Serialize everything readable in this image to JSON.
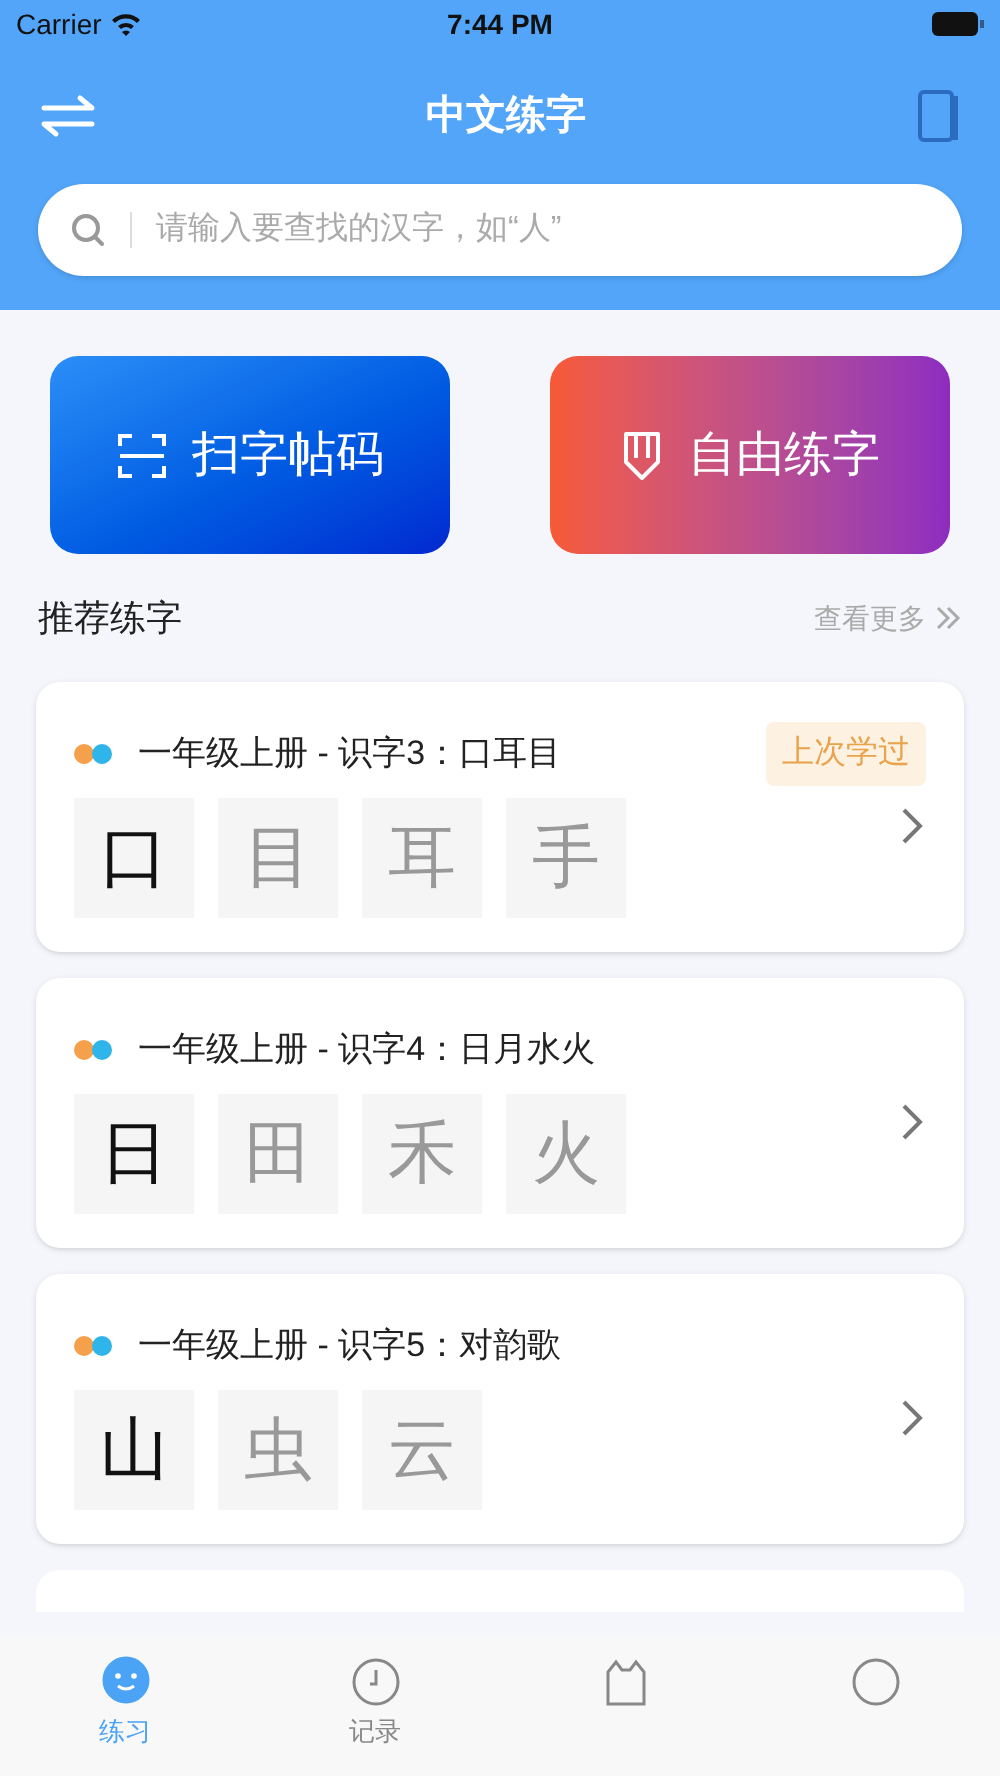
{
  "status_bar": {
    "carrier": "Carrier",
    "time": "7:44 PM"
  },
  "header": {
    "title": "中文练字"
  },
  "search": {
    "placeholder": "请输入要查找的汉字，如“人”"
  },
  "actions": [
    {
      "kind": "scan",
      "label": "扫字帖码"
    },
    {
      "kind": "free",
      "label": "自由练字"
    }
  ],
  "section": {
    "title": "推荐练字",
    "more": "查看更多"
  },
  "lessons": [
    {
      "title": "一年级上册 - 识字3：口耳目",
      "badge": "上次学过",
      "chars": [
        {
          "char": "口",
          "active": true
        },
        {
          "char": "目",
          "active": false
        },
        {
          "char": "耳",
          "active": false
        },
        {
          "char": "手",
          "active": false
        }
      ]
    },
    {
      "title": "一年级上册 - 识字4：日月水火",
      "chars": [
        {
          "char": "日",
          "active": true
        },
        {
          "char": "田",
          "active": false
        },
        {
          "char": "禾",
          "active": false
        },
        {
          "char": "火",
          "active": false
        }
      ]
    },
    {
      "title": "一年级上册 - 识字5：对韵歌",
      "chars": [
        {
          "char": "山",
          "active": true
        },
        {
          "char": "虫",
          "active": false
        },
        {
          "char": "云",
          "active": false
        }
      ]
    }
  ],
  "tabs": [
    {
      "kind": "practice",
      "label": "练习",
      "selected": true
    },
    {
      "kind": "record",
      "label": "记录",
      "selected": false
    }
  ]
}
